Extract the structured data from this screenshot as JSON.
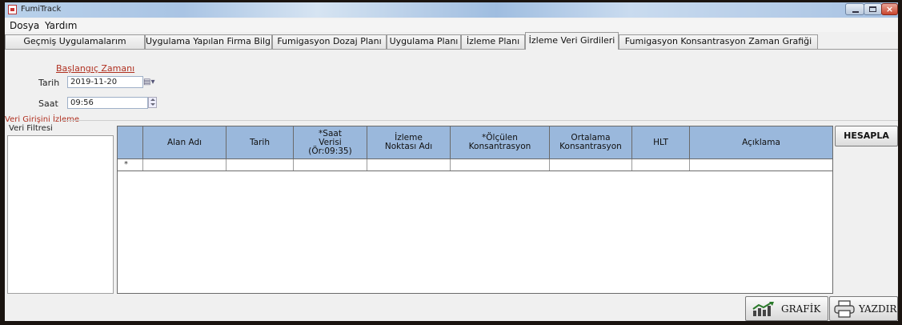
{
  "window": {
    "title": "FumiTrack"
  },
  "menu": {
    "items": [
      "Dosya",
      "Yardım"
    ]
  },
  "tabs": [
    "Geçmiş Uygulamalarım",
    "Uygulama Yapılan Firma Bilgileri",
    "Fumigasyon Dozaj Planı",
    "Uygulama Planı",
    "İzleme Planı",
    "İzleme Veri Girdileri",
    "Fumigasyon Konsantrasyon Zaman Grafiği"
  ],
  "active_tab": "İzleme Veri Girdileri",
  "start": {
    "link_label": "Başlangıç Zamanı",
    "date_label": "Tarih",
    "date_value": "2019-11-20",
    "time_label": "Saat",
    "time_value": "09:56"
  },
  "monitoring": {
    "section_title": "Veri Girişini İzleme",
    "filter_title": "Veri Filtresi"
  },
  "table": {
    "columns": [
      "",
      "Alan Adı",
      "Tarih",
      "*Saat\nVerisi\n(Ör:09:35)",
      "İzleme\nNoktası Adı",
      "*Ölçülen\nKonsantrasyon",
      "Ortalama\nKonsantrasyon",
      "HLT",
      "Açıklama"
    ],
    "new_row_marker": "*"
  },
  "buttons": {
    "calculate": "HESAPLA",
    "chart": "GRAFİK",
    "print": "YAZDIR"
  },
  "colors": {
    "header_bg": "#9ab8dc",
    "link_red": "#b03020"
  }
}
